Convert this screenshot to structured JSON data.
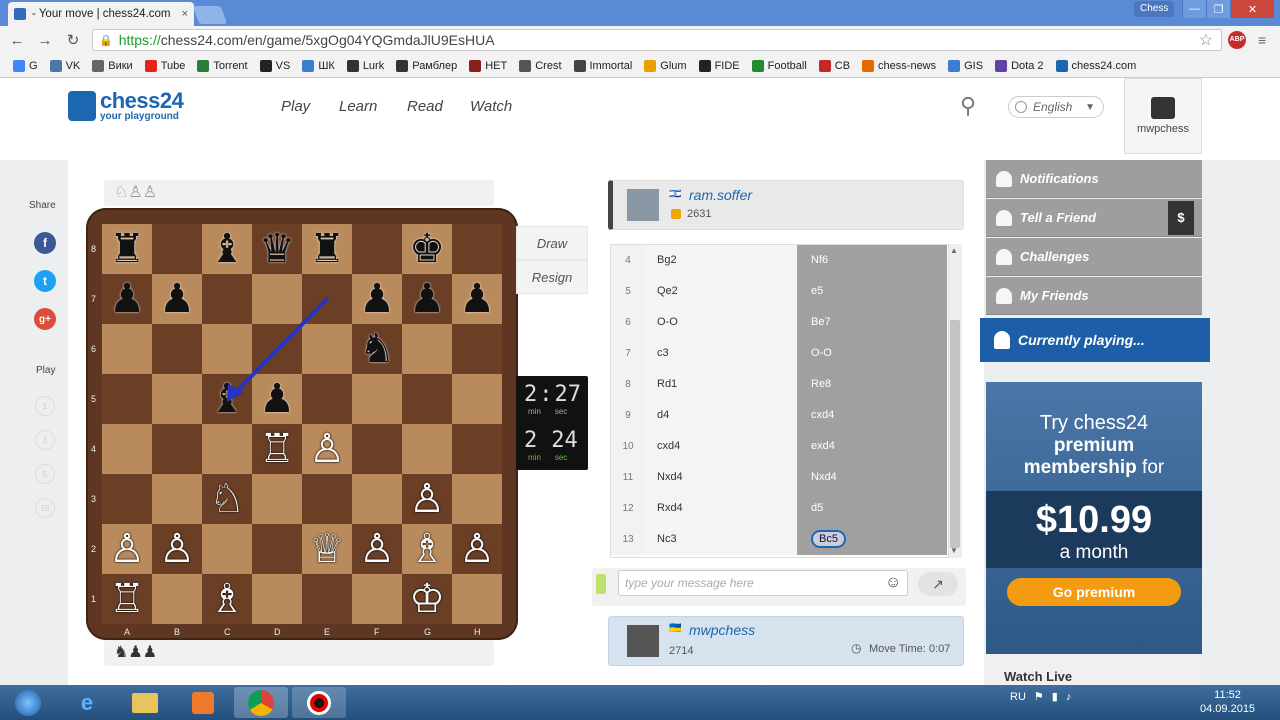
{
  "browser": {
    "tab_title": "- Your move | chess24.com",
    "tab_close": "×",
    "window_label": "Chess",
    "minimize": "—",
    "restore": "❐",
    "close": "✕",
    "url_https": "https://",
    "url_rest": "chess24.com/en/game/5xgOg04YQGmdaJlU9EsHUA",
    "abp_badge": "ABP"
  },
  "bookmarks": [
    {
      "label": "G",
      "color": "#4285f4"
    },
    {
      "label": "VK",
      "color": "#4a76a8"
    },
    {
      "label": "Вики",
      "color": "#666666"
    },
    {
      "label": "Tube",
      "color": "#e62117"
    },
    {
      "label": "Torrent",
      "color": "#2a7d3a"
    },
    {
      "label": "VS",
      "color": "#222222"
    },
    {
      "label": "ШК",
      "color": "#3b7ed1"
    },
    {
      "label": "Lurk",
      "color": "#333333"
    },
    {
      "label": "Рамблер",
      "color": "#333333"
    },
    {
      "label": "НЕТ",
      "color": "#8b1d1d"
    },
    {
      "label": "Crest",
      "color": "#555555"
    },
    {
      "label": "Immortal",
      "color": "#444444"
    },
    {
      "label": "Glum",
      "color": "#e6a100"
    },
    {
      "label": "FIDE",
      "color": "#222222"
    },
    {
      "label": "Football",
      "color": "#1e8c2f"
    },
    {
      "label": "CB",
      "color": "#c62828"
    },
    {
      "label": "chess-news",
      "color": "#e56a00"
    },
    {
      "label": "GIS",
      "color": "#3b7ed1"
    },
    {
      "label": "Dota 2",
      "color": "#6441a5"
    },
    {
      "label": "chess24.com",
      "color": "#1c67b0"
    }
  ],
  "site": {
    "logo_name": "chess24",
    "logo_sub": "your playground",
    "nav": [
      "Play",
      "Learn",
      "Read",
      "Watch"
    ],
    "language": "English",
    "username": "mwpchess"
  },
  "share": {
    "label": "Share",
    "play_label": "Play",
    "facebook": "f",
    "twitter": "t",
    "google": "g+",
    "play_options": [
      "1",
      "3",
      "5",
      "15"
    ]
  },
  "board": {
    "captured_top": "♘♙♙",
    "captured_bottom": "♞♟♟",
    "ranks": [
      "8",
      "7",
      "6",
      "5",
      "4",
      "3",
      "2",
      "1"
    ],
    "files": [
      "A",
      "B",
      "C",
      "D",
      "E",
      "F",
      "G",
      "H"
    ],
    "position": [
      [
        "♜",
        "",
        "♝",
        "♛",
        "♜",
        "",
        "♚",
        ""
      ],
      [
        "♟",
        "♟",
        "",
        "",
        "",
        "♟",
        "♟",
        "♟"
      ],
      [
        "",
        "",
        "",
        "",
        "",
        "♞",
        "",
        ""
      ],
      [
        "",
        "",
        "♝",
        "♟",
        "",
        "",
        "",
        ""
      ],
      [
        "",
        "",
        "",
        "♖",
        "♙",
        "",
        "",
        ""
      ],
      [
        "",
        "",
        "♘",
        "",
        "",
        "",
        "♙",
        ""
      ],
      [
        "♙",
        "♙",
        "",
        "",
        "♕",
        "♙",
        "♗",
        "♙"
      ],
      [
        "♖",
        "",
        "♗",
        "",
        "",
        "",
        "♔",
        ""
      ]
    ],
    "arrow_from": "e7",
    "arrow_to": "c5"
  },
  "actions": {
    "draw": "Draw",
    "resign": "Resign"
  },
  "clock": {
    "top_min": "2",
    "top_sep": ":",
    "top_sec": "27",
    "bottom_min": "2",
    "bottom_sec": "24",
    "min_label": "min",
    "sec_label": "sec"
  },
  "opponent": {
    "name": "ram.soffer",
    "rating": "2631"
  },
  "player": {
    "name": "mwpchess",
    "rating": "2714",
    "move_time_label": "Move Time: 0:07"
  },
  "moves": [
    {
      "n": "4",
      "w": "Bg2",
      "b": "Nf6"
    },
    {
      "n": "5",
      "w": "Qe2",
      "b": "e5"
    },
    {
      "n": "6",
      "w": "O-O",
      "b": "Be7"
    },
    {
      "n": "7",
      "w": "c3",
      "b": "O-O"
    },
    {
      "n": "8",
      "w": "Rd1",
      "b": "Re8"
    },
    {
      "n": "9",
      "w": "d4",
      "b": "cxd4"
    },
    {
      "n": "10",
      "w": "cxd4",
      "b": "exd4"
    },
    {
      "n": "11",
      "w": "Nxd4",
      "b": "Nxd4"
    },
    {
      "n": "12",
      "w": "Rxd4",
      "b": "d5"
    },
    {
      "n": "13",
      "w": "Nc3",
      "b": "Bc5"
    }
  ],
  "chat": {
    "placeholder": "type your message here"
  },
  "sidebar": {
    "items": [
      {
        "label": "Notifications",
        "icon": "bell-icon"
      },
      {
        "label": "Tell a Friend",
        "icon": "friends-icon"
      },
      {
        "label": "Challenges",
        "icon": "pawn-icon"
      },
      {
        "label": "My Friends",
        "icon": "user-icon"
      }
    ],
    "dollar": "$",
    "currently_playing": "Currently playing..."
  },
  "ad": {
    "line1": "Try chess24",
    "line2": "premium",
    "line3a": "membership",
    "line3b": " for",
    "price": "$10.99",
    "period": "a month",
    "cta": "Go premium"
  },
  "watch_live": "Watch Live",
  "taskbar": {
    "lang": "RU",
    "time": "11:52",
    "date": "04.09.2015"
  },
  "colors": {
    "brand": "#1c67b0",
    "cta": "#f39c12"
  }
}
